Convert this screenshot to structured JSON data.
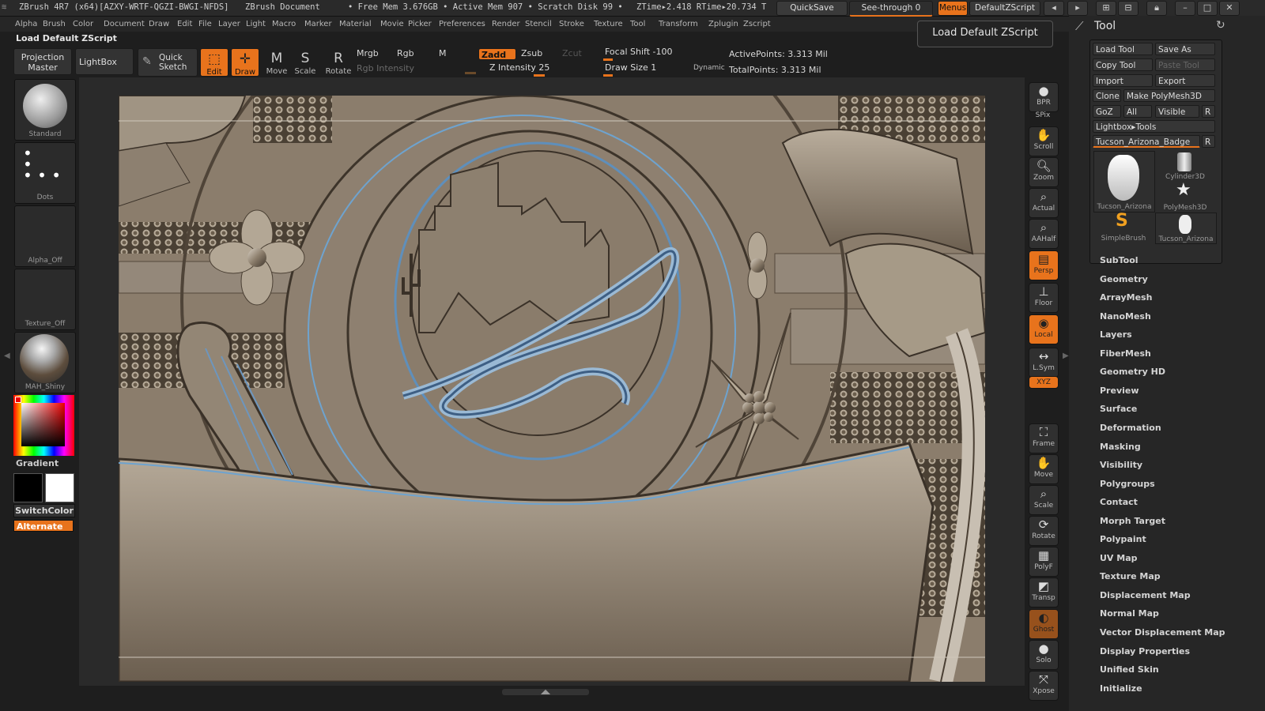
{
  "titlebar": {
    "app": "ZBrush 4R7 (x64)[AZXY-WRTF-QGZI-BWGI-NFDS]",
    "doc": "ZBrush Document",
    "stats": "• Free Mem 3.676GB • Active Mem 907 • Scratch Disk 99 •",
    "ztime": "ZTime▸2.418 RTime▸20.734 T",
    "quicksave": "QuickSave",
    "seethrough": "See-through  0",
    "menus": "Menus",
    "defaultzscript": "DefaultZScript"
  },
  "menubar": [
    "Alpha",
    "Brush",
    "Color",
    "Document",
    "Draw",
    "Edit",
    "File",
    "Layer",
    "Light",
    "Macro",
    "Marker",
    "Material",
    "Movie",
    "Picker",
    "Preferences",
    "Render",
    "Stencil",
    "Stroke",
    "Texture",
    "Tool",
    "Transform",
    "Zplugin",
    "Zscript"
  ],
  "script_label": "Load Default ZScript",
  "tooltip": "Load Default ZScript",
  "toolbar": {
    "projection_master": "Projection Master",
    "lightbox": "LightBox",
    "quick_sketch": "Quick Sketch",
    "edit": "Edit",
    "draw": "Draw",
    "move": "Move",
    "scale": "Scale",
    "rotate": "Rotate",
    "mrgb": "Mrgb",
    "rgb": "Rgb",
    "m": "M",
    "rgb_intensity": "Rgb Intensity",
    "zadd": "Zadd",
    "zsub": "Zsub",
    "zcut": "Zcut",
    "z_intensity": "Z Intensity 25",
    "focal_shift": "Focal Shift -100",
    "draw_size": "Draw Size 1",
    "dynamic": "Dynamic",
    "active_points": "ActivePoints: 3.313 Mil",
    "total_points": "TotalPoints: 3.313 Mil"
  },
  "left_palette": {
    "brush": "Standard",
    "stroke": "Dots",
    "alpha": "Alpha_Off",
    "texture": "Texture_Off",
    "material": "MAH_Shiny",
    "gradient": "Gradient",
    "switchcolor": "SwitchColor",
    "alternate": "Alternate"
  },
  "right_shelf": [
    "BPR",
    "SPix",
    "Scroll",
    "Zoom",
    "Actual",
    "AAHalf",
    "Persp",
    "Floor",
    "Local",
    "L.Sym",
    "XYZ",
    "Frame",
    "Move",
    "Scale",
    "Rotate",
    "PolyF",
    "Transp",
    "Ghost",
    "Solo",
    "Xpose"
  ],
  "tool_panel": {
    "title": "Tool",
    "load_tool": "Load Tool",
    "save_as": "Save As",
    "copy_tool": "Copy Tool",
    "paste_tool": "Paste Tool",
    "import": "Import",
    "export": "Export",
    "clone": "Clone",
    "make_polymesh": "Make PolyMesh3D",
    "goz": "GoZ",
    "all": "All",
    "visible": "Visible",
    "r": "R",
    "lightbox_tools": "Lightbox▸Tools",
    "current_tool": "Tucson_Arizona_Badge",
    "thumbs": [
      "Tucson_Arizona",
      "Cylinder3D",
      "PolyMesh3D",
      "SimpleBrush",
      "Tucson_Arizona"
    ],
    "sections": [
      "SubTool",
      "Geometry",
      "ArrayMesh",
      "NanoMesh",
      "Layers",
      "FiberMesh",
      "Geometry HD",
      "Preview",
      "Surface",
      "Deformation",
      "Masking",
      "Visibility",
      "Polygroups",
      "Contact",
      "Morph Target",
      "Polypaint",
      "UV Map",
      "Texture Map",
      "Displacement Map",
      "Normal Map",
      "Vector Displacement Map",
      "Display Properties",
      "Unified Skin",
      "Initialize"
    ]
  },
  "colors": {
    "accent": "#e8731c",
    "bg": "#262626",
    "canvas": "#8d7f6e"
  }
}
